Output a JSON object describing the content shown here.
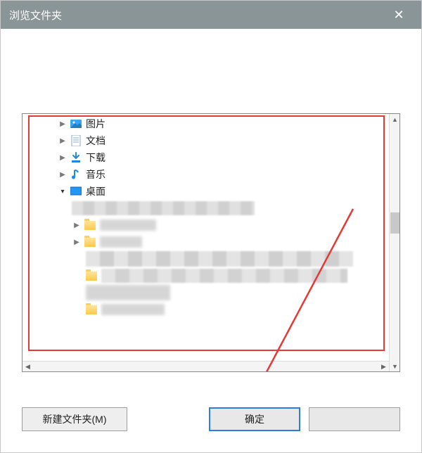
{
  "dialog": {
    "title": "浏览文件夹"
  },
  "tree": {
    "pictures": "图片",
    "documents": "文档",
    "downloads": "下载",
    "music": "音乐",
    "desktop": "桌面"
  },
  "footer": {
    "new_folder": "新建文件夹(M)",
    "ok": "确定",
    "cancel": ""
  },
  "colors": {
    "titlebar": "#8a9598",
    "annotation_red": "#e53935",
    "ok_border": "#2b7de1"
  }
}
